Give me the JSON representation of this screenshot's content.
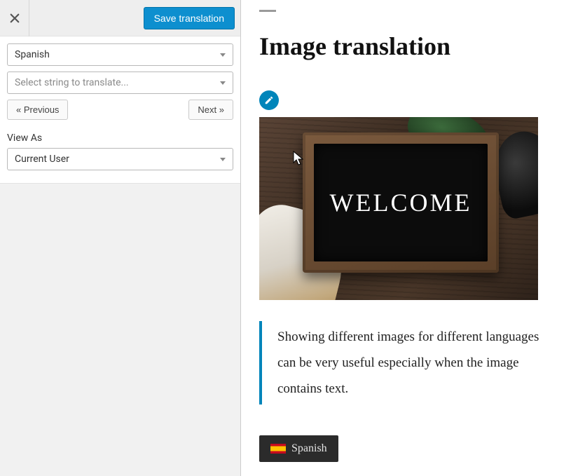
{
  "toolbar": {
    "save_label": "Save translation"
  },
  "sidebar": {
    "language_select": "Spanish",
    "string_select_placeholder": "Select string to translate...",
    "prev_label": "« Previous",
    "next_label": "Next »",
    "view_as_label": "View As",
    "view_as_value": "Current User"
  },
  "preview": {
    "title": "Image translation",
    "board_text": "WELCOME",
    "quote": "Showing different images for different languages can be very useful especially when the image contains text.",
    "lang_switcher": "Spanish"
  },
  "icons": {
    "close": "close-icon",
    "edit": "pencil-icon",
    "caret": "caret-down-icon",
    "flag_es": "flag-spain-icon"
  },
  "colors": {
    "accent": "#0085ba"
  }
}
